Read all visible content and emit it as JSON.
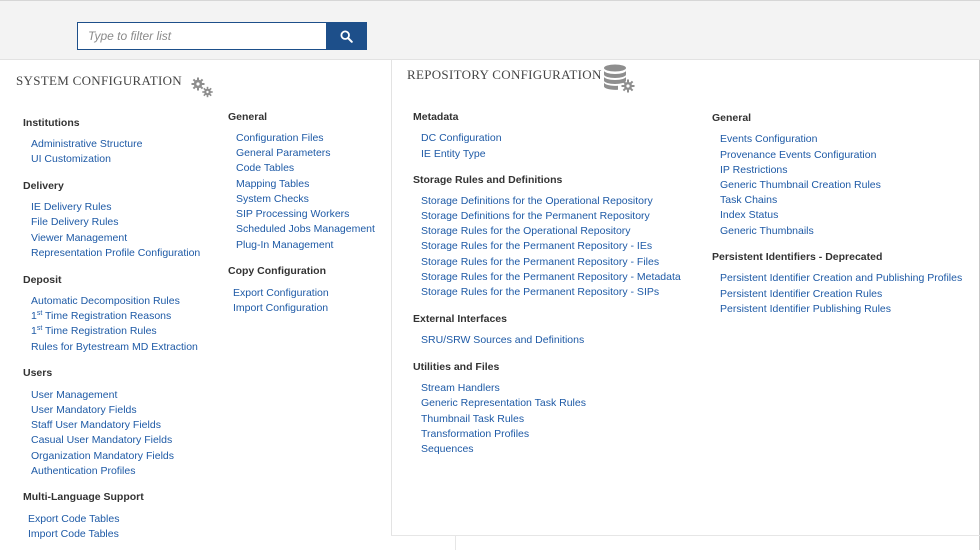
{
  "search": {
    "placeholder": "Type to filter list"
  },
  "system": {
    "title": "SYSTEM CONFIGURATION",
    "icon": "gears-icon",
    "groups": [
      {
        "heading": "Institutions",
        "items": [
          "Administrative Structure",
          "UI Customization"
        ]
      },
      {
        "heading": "Delivery",
        "items": [
          "IE Delivery Rules",
          "File Delivery Rules",
          "Viewer Management",
          "Representation Profile Configuration"
        ]
      },
      {
        "heading": "Deposit",
        "items": [
          "Automatic Decomposition Rules",
          "1st Time Registration Reasons",
          "1st Time Registration Rules",
          "Rules for Bytestream MD Extraction"
        ]
      },
      {
        "heading": "Users",
        "items": [
          "User Management",
          "User Mandatory Fields",
          "Staff User Mandatory Fields",
          "Casual User Mandatory Fields",
          "Organization Mandatory Fields",
          "Authentication Profiles"
        ]
      },
      {
        "heading": "Multi-Language Support",
        "items": [
          "Export Code Tables",
          "Import Code Tables"
        ]
      },
      {
        "heading": "General",
        "items": [
          "Configuration Files",
          "General Parameters",
          "Code Tables",
          "Mapping Tables",
          "System Checks",
          "SIP Processing Workers",
          "Scheduled Jobs Management",
          "Plug-In Management"
        ]
      },
      {
        "heading": "Copy Configuration",
        "items": [
          "Export Configuration",
          "Import Configuration"
        ]
      }
    ]
  },
  "repository": {
    "title": "REPOSITORY CONFIGURATION",
    "icon": "database-gear-icon",
    "groups": [
      {
        "heading": "Metadata",
        "items": [
          "DC Configuration",
          "IE Entity Type"
        ]
      },
      {
        "heading": "Storage Rules and Definitions",
        "items": [
          "Storage Definitions for the Operational Repository",
          "Storage Definitions for the Permanent Repository",
          "Storage Rules for the Operational Repository",
          "Storage Rules for the Permanent Repository - IEs",
          "Storage Rules for the Permanent Repository - Files",
          "Storage Rules for the Permanent Repository - Metadata",
          "Storage Rules for the Permanent Repository - SIPs"
        ]
      },
      {
        "heading": "External Interfaces",
        "items": [
          "SRU/SRW Sources and Definitions"
        ]
      },
      {
        "heading": "Utilities and Files",
        "items": [
          "Stream Handlers",
          "Generic Representation Task Rules",
          "Thumbnail Task Rules",
          "Transformation Profiles",
          "Sequences"
        ]
      },
      {
        "heading": "General",
        "items": [
          "Events Configuration",
          "Provenance Events Configuration",
          "IP Restrictions",
          "Generic Thumbnail Creation Rules",
          "Task Chains",
          "Index Status",
          "Generic Thumbnails"
        ]
      },
      {
        "heading": "Persistent Identifiers - Deprecated",
        "items": [
          "Persistent Identifier Creation and Publishing Profiles",
          "Persistent Identifier Creation Rules",
          "Persistent Identifier Publishing Rules"
        ]
      }
    ]
  },
  "colors": {
    "link": "#1e5aa6",
    "search_button": "#1d4f8a"
  }
}
